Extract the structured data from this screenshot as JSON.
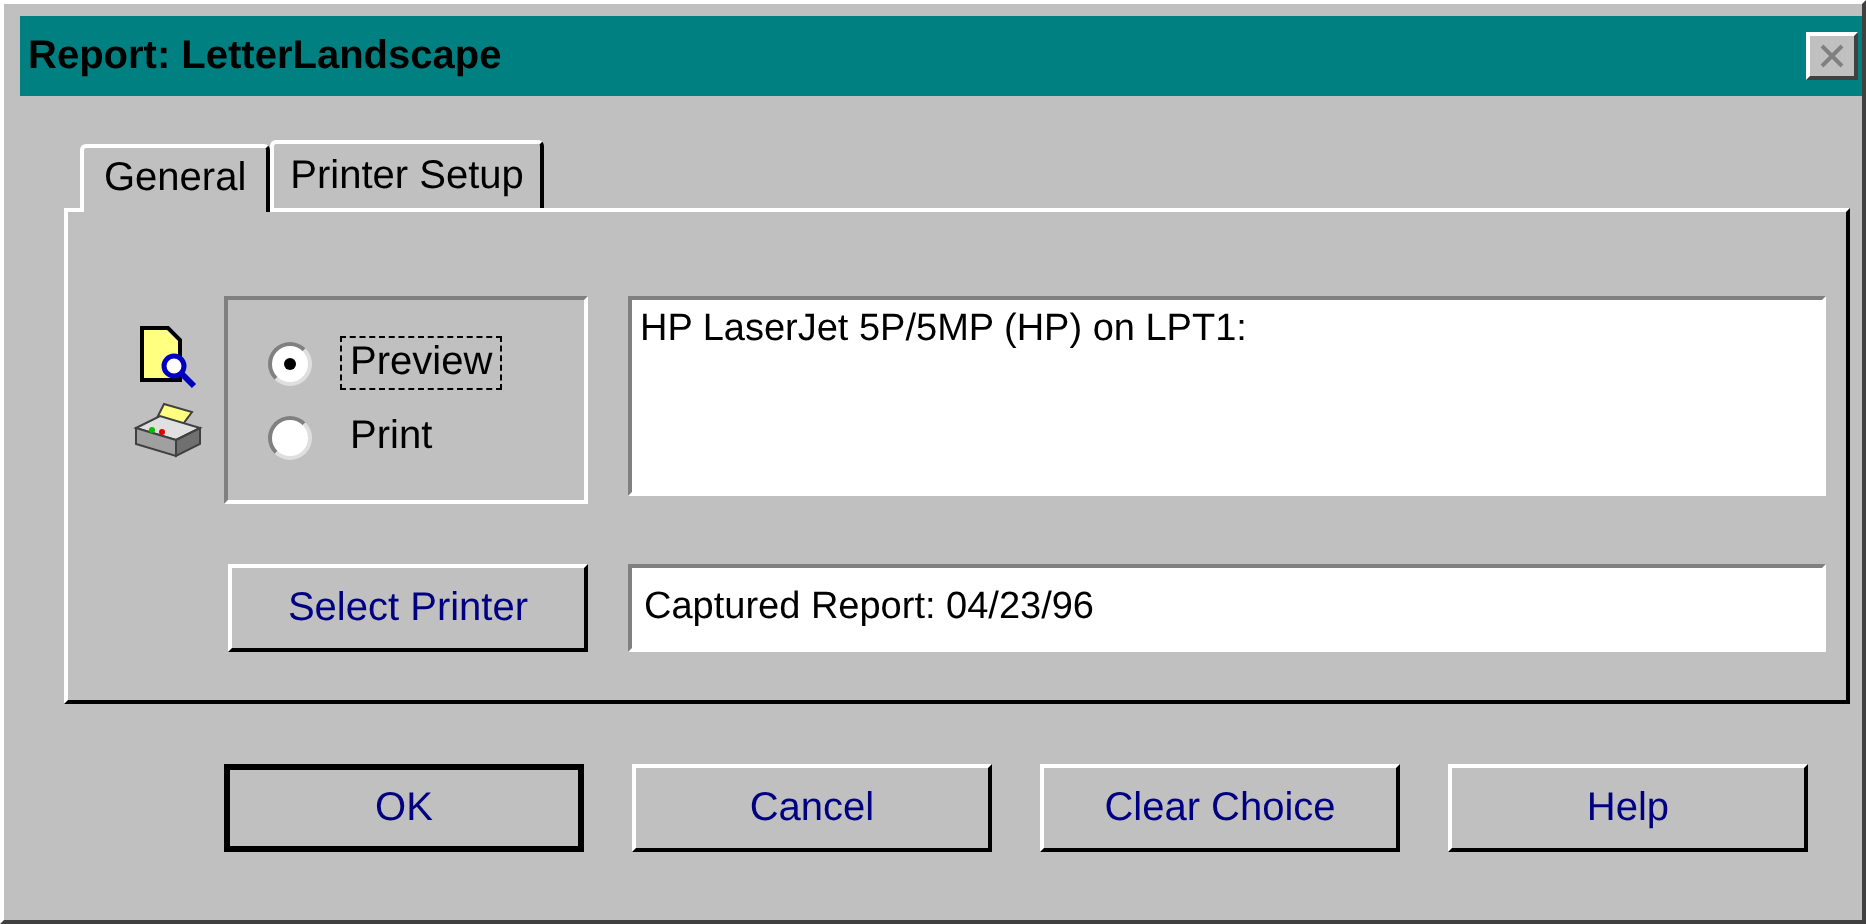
{
  "window": {
    "title": "Report: LetterLandscape"
  },
  "tabs": [
    {
      "label": "General",
      "selected": true
    },
    {
      "label": "Printer Setup",
      "selected": false
    }
  ],
  "output_options": [
    {
      "label": "Preview",
      "selected": true,
      "focused": true
    },
    {
      "label": "Print",
      "selected": false,
      "focused": false
    }
  ],
  "printer": {
    "value": "HP LaserJet 5P/5MP (HP) on LPT1:"
  },
  "select_printer_button": "Select Printer",
  "report_field": {
    "value": "Captured Report: 04/23/96"
  },
  "buttons": [
    {
      "label": "OK",
      "default": true
    },
    {
      "label": "Cancel",
      "default": false
    },
    {
      "label": "Clear Choice",
      "default": false
    },
    {
      "label": "Help",
      "default": false
    }
  ]
}
